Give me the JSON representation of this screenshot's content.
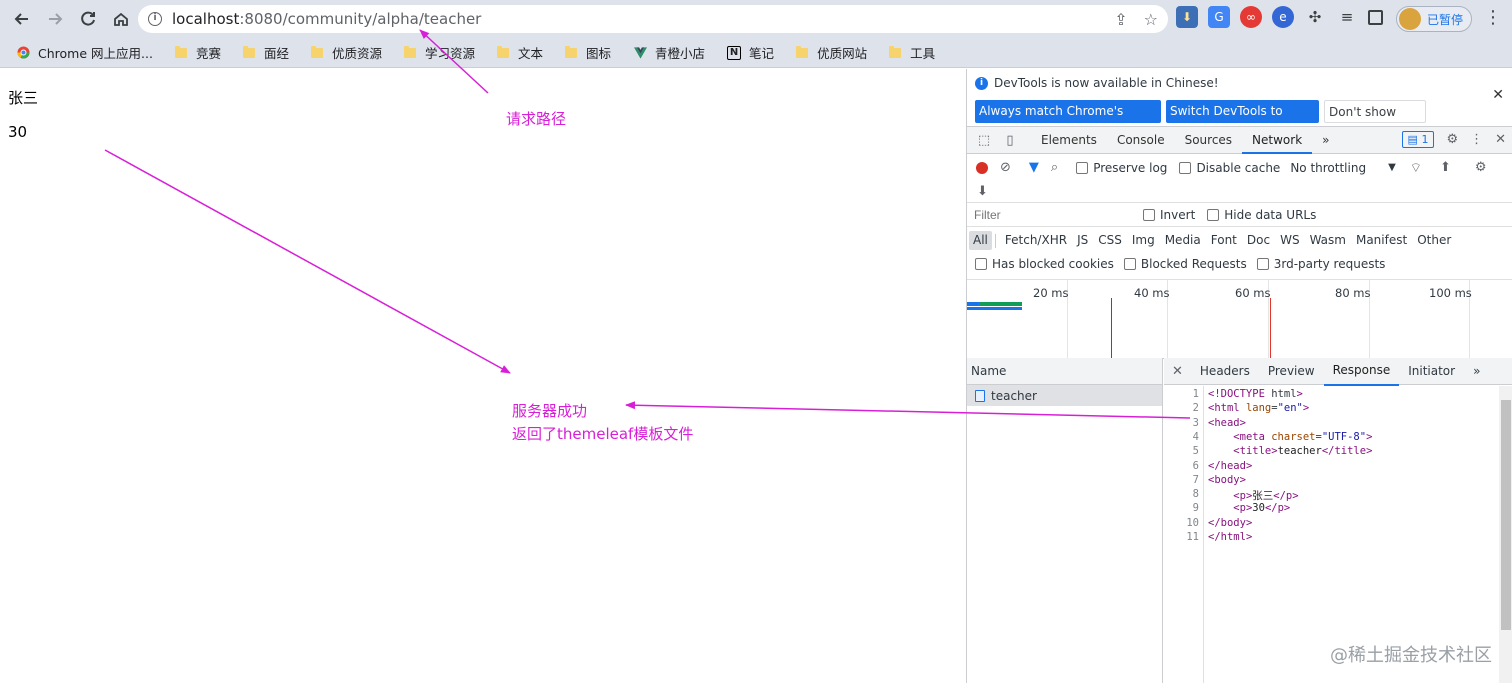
{
  "browser": {
    "url_host": "localhost",
    "url_path": ":8080/community/alpha/teacher",
    "profile_label": "已暂停"
  },
  "bookmarks": [
    {
      "label": "Chrome 网上应用...",
      "icon": "chrome-webstore-icon"
    },
    {
      "label": "竞赛",
      "icon": "folder-icon"
    },
    {
      "label": "面经",
      "icon": "folder-icon"
    },
    {
      "label": "优质资源",
      "icon": "folder-icon"
    },
    {
      "label": "学习资源",
      "icon": "folder-icon"
    },
    {
      "label": "文本",
      "icon": "folder-icon"
    },
    {
      "label": "图标",
      "icon": "folder-icon"
    },
    {
      "label": "青橙小店",
      "icon": "vue-icon"
    },
    {
      "label": "笔记",
      "icon": "notion-icon"
    },
    {
      "label": "优质网站",
      "icon": "folder-icon"
    },
    {
      "label": "工具",
      "icon": "folder-icon"
    }
  ],
  "page": {
    "name": "张三",
    "age": "30"
  },
  "annotations": {
    "request_path": "请求路径",
    "server_line1": "服务器成功",
    "server_line2": "返回了themeleaf模板文件",
    "color": "#d81fd8"
  },
  "devtools": {
    "banner_message": "DevTools is now available in Chinese!",
    "btn_match": "Always match Chrome's language",
    "btn_switch": "Switch DevTools to Chinese",
    "btn_dont_show": "Don't show again",
    "tabs": [
      "Elements",
      "Console",
      "Sources",
      "Network"
    ],
    "active_tab": "Network",
    "issues_count": "1",
    "preserve_log": "Preserve log",
    "disable_cache": "Disable cache",
    "throttling": "No throttling",
    "filter_placeholder": "Filter",
    "invert": "Invert",
    "hide_data_urls": "Hide data URLs",
    "types": [
      "All",
      "Fetch/XHR",
      "JS",
      "CSS",
      "Img",
      "Media",
      "Font",
      "Doc",
      "WS",
      "Wasm",
      "Manifest",
      "Other"
    ],
    "has_blocked_cookies": "Has blocked cookies",
    "blocked_requests": "Blocked Requests",
    "third_party": "3rd-party requests",
    "timeline_ticks": [
      "20 ms",
      "40 ms",
      "60 ms",
      "80 ms",
      "100 ms"
    ],
    "name_header": "Name",
    "request_name": "teacher",
    "detail_tabs": [
      "Headers",
      "Preview",
      "Response",
      "Initiator"
    ],
    "active_detail_tab": "Response"
  },
  "response_lines": [
    "<!DOCTYPE html>",
    "<html lang=\"en\">",
    "<head>",
    "    <meta charset=\"UTF-8\">",
    "    <title>teacher</title>",
    "</head>",
    "<body>",
    "    <p>张三</p>",
    "    <p>30</p>",
    "</body>",
    "</html>"
  ],
  "watermark": "@稀土掘金技术社区"
}
